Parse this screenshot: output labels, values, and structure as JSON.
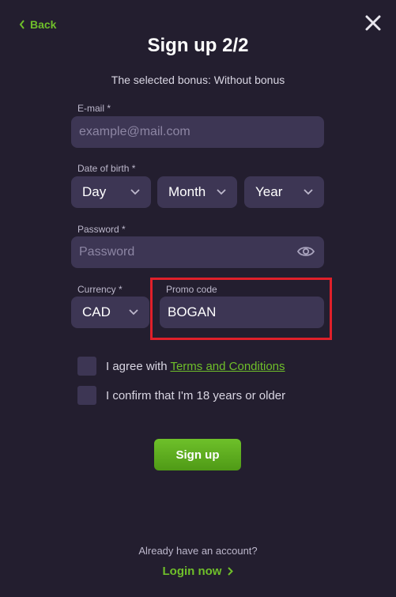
{
  "nav": {
    "back_label": "Back"
  },
  "header": {
    "title": "Sign up 2/2",
    "subtitle": "The selected bonus: Without bonus"
  },
  "form": {
    "email": {
      "label": "E-mail *",
      "placeholder": "example@mail.com"
    },
    "dob": {
      "label": "Date of birth *",
      "day": "Day",
      "month": "Month",
      "year": "Year"
    },
    "password": {
      "label": "Password *",
      "placeholder": "Password"
    },
    "currency": {
      "label": "Currency *",
      "value": "CAD"
    },
    "promo": {
      "label": "Promo code",
      "value": "BOGAN"
    }
  },
  "checkboxes": {
    "terms_prefix": "I agree with ",
    "terms_link": "Terms and Conditions",
    "age": "I confirm that I'm 18 years or older"
  },
  "actions": {
    "signup_label": "Sign up"
  },
  "footer": {
    "already_text": "Already have an account?",
    "login_label": "Login now"
  },
  "colors": {
    "accent": "#6fbf2a",
    "background": "#231e2f",
    "field": "#3d3654",
    "highlight": "#e0202a"
  },
  "icons": {
    "back": "chevron-left-icon",
    "close": "close-icon",
    "dropdown": "chevron-down-icon",
    "eye": "eye-icon",
    "login": "chevron-right-icon"
  }
}
